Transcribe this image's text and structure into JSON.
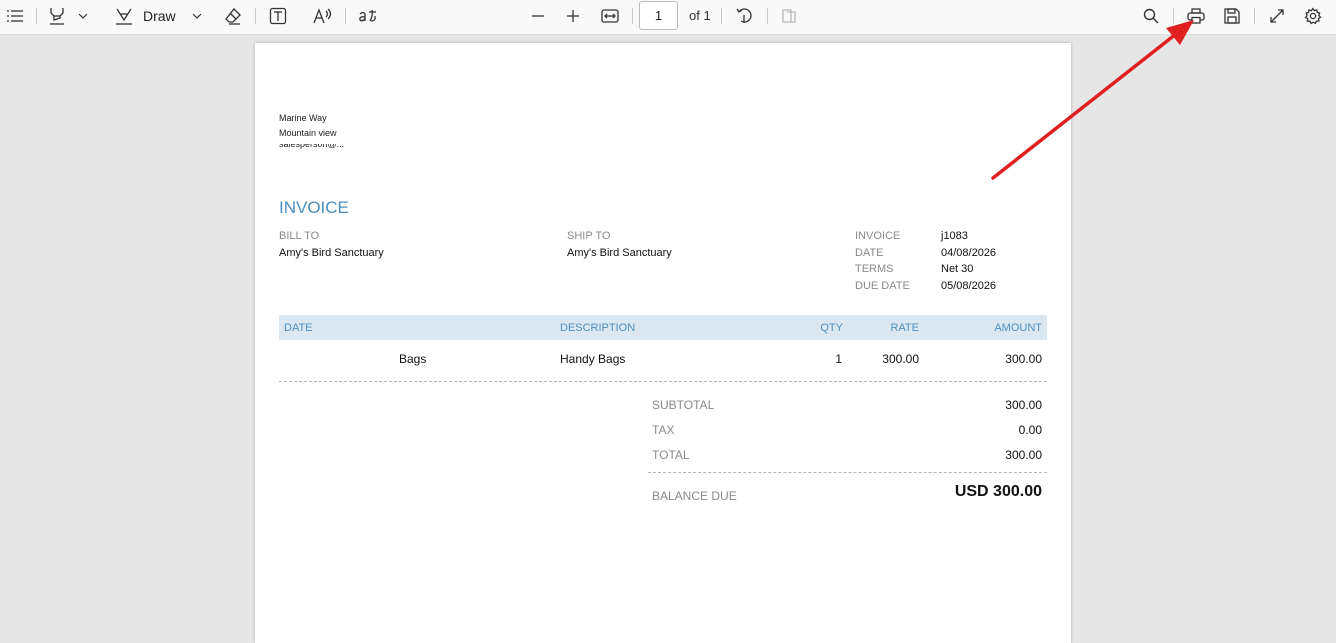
{
  "toolbar": {
    "draw_label": "Draw",
    "page_number": "1",
    "page_of": "of 1",
    "icons": [
      "contents-icon",
      "highlight-icon",
      "chevron-down-icon",
      "draw-icon",
      "chevron-down-icon",
      "eraser-icon",
      "text-box-icon",
      "read-aloud-icon",
      "translate-icon",
      "zoom-out-icon",
      "zoom-in-icon",
      "fit-width-icon",
      "rotate-icon",
      "two-page-icon",
      "search-icon",
      "print-icon",
      "save-icon",
      "fullscreen-icon",
      "settings-icon"
    ]
  },
  "document": {
    "address_line1": "Marine Way",
    "address_line2": "Mountain view",
    "address_line3": "salesperson@...",
    "title": "INVOICE",
    "bill_to_label": "BILL TO",
    "bill_to": "Amy's Bird Sanctuary",
    "ship_to_label": "SHIP TO",
    "ship_to": "Amy's Bird Sanctuary",
    "meta": [
      {
        "label": "INVOICE",
        "value": "j1083"
      },
      {
        "label": "DATE",
        "value": "04/08/2026"
      },
      {
        "label": "TERMS",
        "value": "Net 30"
      },
      {
        "label": "DUE DATE",
        "value": "05/08/2026"
      }
    ],
    "columns": {
      "date": "DATE",
      "description": "DESCRIPTION",
      "qty": "QTY",
      "rate": "RATE",
      "amount": "AMOUNT"
    },
    "lines": [
      {
        "date": "Bags",
        "description": "Handy Bags",
        "qty": "1",
        "rate": "300.00",
        "amount": "300.00"
      }
    ],
    "subtotal_label": "SUBTOTAL",
    "subtotal": "300.00",
    "tax_label": "TAX",
    "tax": "0.00",
    "total_label": "TOTAL",
    "total": "300.00",
    "balance_label": "BALANCE DUE",
    "balance": "USD 300.00"
  },
  "colors": {
    "accent": "#4b8fbf",
    "table_header_bg": "#dce8f1",
    "annotation_arrow": "#e02020"
  }
}
